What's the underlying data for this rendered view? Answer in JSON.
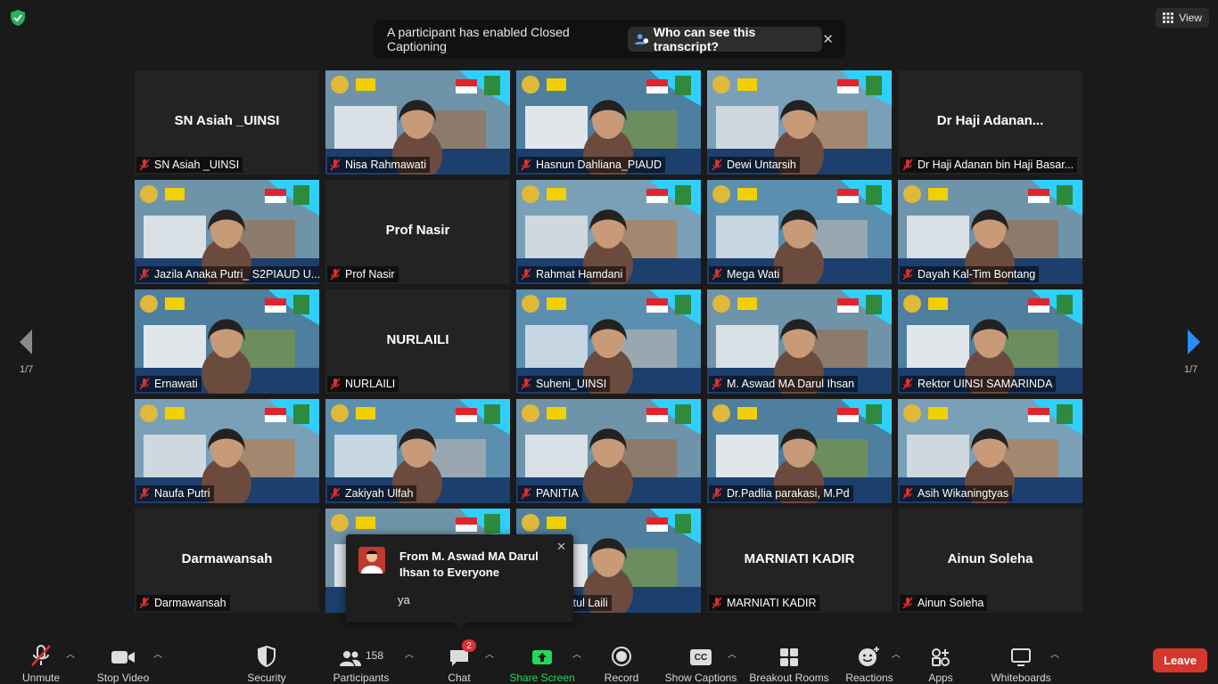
{
  "top": {
    "view_label": "View",
    "caption_banner_text": "A participant has enabled Closed Captioning",
    "caption_banner_link": "Who can see this transcript?",
    "close_glyph": "✕"
  },
  "pagination": {
    "left": "1/7",
    "right": "1/7"
  },
  "tiles": [
    {
      "big_name": "SN Asiah _UINSI",
      "label": "SN Asiah _UINSI",
      "video": false
    },
    {
      "big_name": "",
      "label": "Nisa Rahmawati",
      "video": true
    },
    {
      "big_name": "",
      "label": "Hasnun Dahliana_PIAUD",
      "video": true
    },
    {
      "big_name": "",
      "label": "Dewi Untarsih",
      "video": true
    },
    {
      "big_name": "Dr  Haji  Adanan...",
      "label": "Dr Haji Adanan bin Haji Basar...",
      "video": false
    },
    {
      "big_name": "",
      "label": "Jazila Anaka Putri_ S2PIAUD U...",
      "video": true
    },
    {
      "big_name": "Prof Nasir",
      "label": "Prof Nasir",
      "video": false
    },
    {
      "big_name": "",
      "label": "Rahmat Hamdani",
      "video": true
    },
    {
      "big_name": "",
      "label": "Mega Wati",
      "video": true
    },
    {
      "big_name": "",
      "label": "Dayah Kal-Tim Bontang",
      "video": true
    },
    {
      "big_name": "",
      "label": "Ernawati",
      "video": true
    },
    {
      "big_name": "NURLAILI",
      "label": "NURLAILI",
      "video": false
    },
    {
      "big_name": "",
      "label": "Suheni_UINSI",
      "video": true
    },
    {
      "big_name": "",
      "label": "M. Aswad MA Darul Ihsan",
      "video": true
    },
    {
      "big_name": "",
      "label": "Rektor UINSI SAMARINDA",
      "video": true
    },
    {
      "big_name": "",
      "label": "Naufa Putri",
      "video": true
    },
    {
      "big_name": "",
      "label": "Zakiyah Ulfah",
      "video": true
    },
    {
      "big_name": "",
      "label": "PANITIA",
      "video": true
    },
    {
      "big_name": "",
      "label": "Dr.Padlia parakasi, M.Pd",
      "video": true
    },
    {
      "big_name": "",
      "label": "Asih Wikaningtyas",
      "video": true
    },
    {
      "big_name": "Darmawansah",
      "label": "Darmawansah",
      "video": false
    },
    {
      "big_name": "",
      "label": "",
      "video": true
    },
    {
      "big_name": "",
      "label": "Magfiratul Laili",
      "video": true
    },
    {
      "big_name": "MARNIATI KADIR",
      "label": "MARNIATI KADIR",
      "video": false
    },
    {
      "big_name": "Ainun Soleha",
      "label": "Ainun Soleha",
      "video": false
    }
  ],
  "chat_popup": {
    "from": "From M. Aswad MA Darul Ihsan to Everyone",
    "message": "ya",
    "close_glyph": "✕"
  },
  "toolbar": {
    "unmute": "Unmute",
    "stop_video": "Stop Video",
    "security": "Security",
    "participants": "Participants",
    "participants_count": "158",
    "chat": "Chat",
    "chat_badge": "2",
    "share_screen": "Share Screen",
    "record": "Record",
    "show_captions": "Show Captions",
    "breakout_rooms": "Breakout Rooms",
    "reactions": "Reactions",
    "apps": "Apps",
    "whiteboards": "Whiteboards",
    "leave": "Leave",
    "cc_glyph": "CC"
  },
  "colors": {
    "background": "#1a1a1a",
    "tile": "#232323",
    "active_speaker": "#e9e24a",
    "share_screen": "#23d959",
    "leave": "#d6372d",
    "mute_red": "#e02f2f"
  }
}
